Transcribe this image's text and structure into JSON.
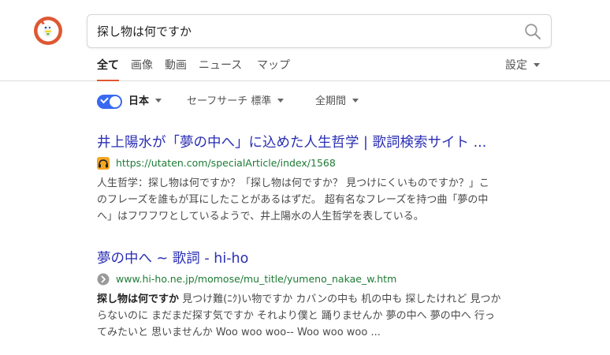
{
  "search": {
    "query": "探し物は何ですか"
  },
  "tabs": [
    "全て",
    "画像",
    "動画",
    "ニュース",
    "マップ"
  ],
  "settings_label": "設定",
  "filters": {
    "region": "日本",
    "safesearch": "セーフサーチ 標準",
    "time": "全期間"
  },
  "results": [
    {
      "title": "井上陽水が「夢の中へ」に込めた人生哲学 | 歌詞検索サイト ...",
      "url": "https://utaten.com/specialArticle/index/1568",
      "snippet_lines": [
        "人生哲学：探し物は何ですか？「探し物は何ですか？ 見つけにくいものですか？」こ",
        "のフレーズを誰もが耳にしたことがあるはずだ。 超有名なフレーズを持つ曲「夢の中",
        "へ」はフワフワとしているようで、井上陽水の人生哲学を表している。"
      ]
    },
    {
      "title_main": "夢の中へ ~ 歌詞",
      "title_suffix": " - hi-ho",
      "url": "www.hi-ho.ne.jp/momose/mu_title/yumeno_nakae_w.htm",
      "snippet_bold": "探し物は何ですか",
      "snippet_line1_rest": " 見つけ難(ﾆｸ)い物ですか カバンの中も 机の中も 探したけれど 見つか",
      "snippet_line2": "らないのに まだまだ探す気ですか それより僕と 踊りませんか 夢の中へ 夢の中へ 行っ",
      "snippet_line3": "てみたいと 思いませんか Woo woo woo-- Woo woo woo ..."
    }
  ],
  "colors": {
    "accent": "#de5833",
    "link": "#2a2fb3",
    "url": "#1e7b35",
    "toggle": "#3969ef"
  }
}
